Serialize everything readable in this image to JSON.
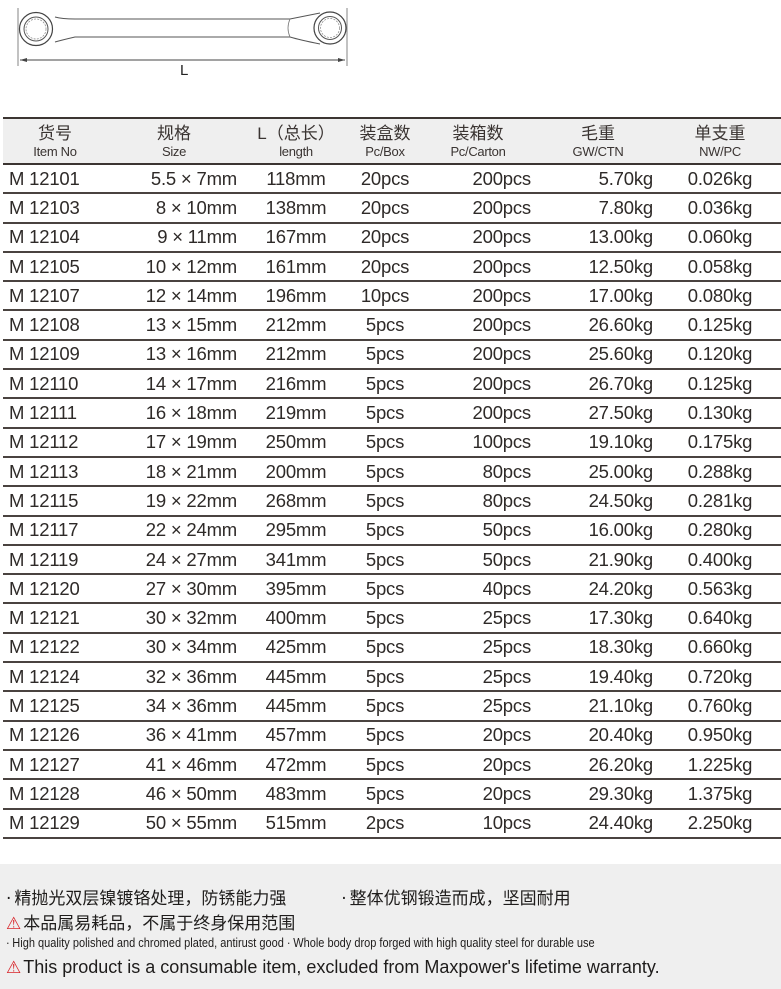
{
  "drawing": {
    "icon": "double-ring-wrench-diagram",
    "dimension_label": "L"
  },
  "table": {
    "headers": [
      {
        "zh": "货号",
        "en": "Item No"
      },
      {
        "zh": "规格",
        "en": "Size"
      },
      {
        "zh": "L（总长）",
        "en": "length"
      },
      {
        "zh": "装盒数",
        "en": "Pc/Box"
      },
      {
        "zh": "装箱数",
        "en": "Pc/Carton"
      },
      {
        "zh": "毛重",
        "en": "GW/CTN"
      },
      {
        "zh": "单支重",
        "en": "NW/PC"
      }
    ],
    "rows": [
      [
        "M 12101",
        "5.5 × 7mm",
        "118mm",
        "20pcs",
        "200pcs",
        "5.70kg",
        "0.026kg"
      ],
      [
        "M 12103",
        "8 × 10mm",
        "138mm",
        "20pcs",
        "200pcs",
        "7.80kg",
        "0.036kg"
      ],
      [
        "M 12104",
        "9 × 11mm",
        "167mm",
        "20pcs",
        "200pcs",
        "13.00kg",
        "0.060kg"
      ],
      [
        "M 12105",
        "10 × 12mm",
        "161mm",
        "20pcs",
        "200pcs",
        "12.50kg",
        "0.058kg"
      ],
      [
        "M 12107",
        "12 × 14mm",
        "196mm",
        "10pcs",
        "200pcs",
        "17.00kg",
        "0.080kg"
      ],
      [
        "M 12108",
        "13 × 15mm",
        "212mm",
        "5pcs",
        "200pcs",
        "26.60kg",
        "0.125kg"
      ],
      [
        "M 12109",
        "13 × 16mm",
        "212mm",
        "5pcs",
        "200pcs",
        "25.60kg",
        "0.120kg"
      ],
      [
        "M 12110",
        "14 × 17mm",
        "216mm",
        "5pcs",
        "200pcs",
        "26.70kg",
        "0.125kg"
      ],
      [
        "M 12111",
        "16 × 18mm",
        "219mm",
        "5pcs",
        "200pcs",
        "27.50kg",
        "0.130kg"
      ],
      [
        "M 12112",
        "17 × 19mm",
        "250mm",
        "5pcs",
        "100pcs",
        "19.10kg",
        "0.175kg"
      ],
      [
        "M 12113",
        "18 × 21mm",
        "200mm",
        "5pcs",
        "80pcs",
        "25.00kg",
        "0.288kg"
      ],
      [
        "M 12115",
        "19 × 22mm",
        "268mm",
        "5pcs",
        "80pcs",
        "24.50kg",
        "0.281kg"
      ],
      [
        "M 12117",
        "22 × 24mm",
        "295mm",
        "5pcs",
        "50pcs",
        "16.00kg",
        "0.280kg"
      ],
      [
        "M 12119",
        "24 × 27mm",
        "341mm",
        "5pcs",
        "50pcs",
        "21.90kg",
        "0.400kg"
      ],
      [
        "M 12120",
        "27 × 30mm",
        "395mm",
        "5pcs",
        "40pcs",
        "24.20kg",
        "0.563kg"
      ],
      [
        "M 12121",
        "30 × 32mm",
        "400mm",
        "5pcs",
        "25pcs",
        "17.30kg",
        "0.640kg"
      ],
      [
        "M 12122",
        "30 × 34mm",
        "425mm",
        "5pcs",
        "25pcs",
        "18.30kg",
        "0.660kg"
      ],
      [
        "M 12124",
        "32 × 36mm",
        "445mm",
        "5pcs",
        "25pcs",
        "19.40kg",
        "0.720kg"
      ],
      [
        "M 12125",
        "34 × 36mm",
        "445mm",
        "5pcs",
        "25pcs",
        "21.10kg",
        "0.760kg"
      ],
      [
        "M 12126",
        "36 × 41mm",
        "457mm",
        "5pcs",
        "20pcs",
        "20.40kg",
        "0.950kg"
      ],
      [
        "M 12127",
        "41 × 46mm",
        "472mm",
        "5pcs",
        "20pcs",
        "26.20kg",
        "1.225kg"
      ],
      [
        "M 12128",
        "46 × 50mm",
        "483mm",
        "5pcs",
        "20pcs",
        "29.30kg",
        "1.375kg"
      ],
      [
        "M 12129",
        "50 × 55mm",
        "515mm",
        "2pcs",
        "10pcs",
        "24.40kg",
        "2.250kg"
      ]
    ]
  },
  "notes": {
    "bullet": "·",
    "warning_icon": "⚠",
    "zh_feature_1": "精抛光双层镍镀铬处理，防锈能力强",
    "zh_feature_2": "整体优钢锻造而成，坚固耐用",
    "zh_warning": "本品属易耗品，不属于终身保用范围",
    "en_feature_1": "High quality polished and chromed plated, antirust good",
    "en_feature_2": "Whole body drop forged with high quality steel for durable use",
    "en_warning": "This product is a consumable item, excluded from Maxpower's lifetime warranty.",
    "warning_color": "#d8262b"
  }
}
